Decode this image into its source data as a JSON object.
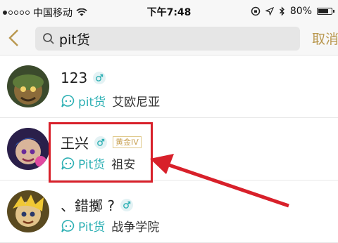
{
  "status_bar": {
    "carrier": "中国移动",
    "time": "下午7:48",
    "battery": "80%",
    "battery_level": 0.8
  },
  "nav": {
    "search_value": "pit货",
    "cancel_label": "取消"
  },
  "results": [
    {
      "name": "123",
      "source": "pit货",
      "server": "艾欧尼亚",
      "rank": ""
    },
    {
      "name": "王兴",
      "source": "Pit货",
      "server": "祖安",
      "rank": "黄金IV"
    },
    {
      "name": "、錯擲 ?",
      "source": "Pit货",
      "server": "战争学院",
      "rank": ""
    }
  ],
  "colors": {
    "accent": "#b9974e",
    "teal": "#2eb0b4",
    "annotation_red": "#d8202a"
  }
}
